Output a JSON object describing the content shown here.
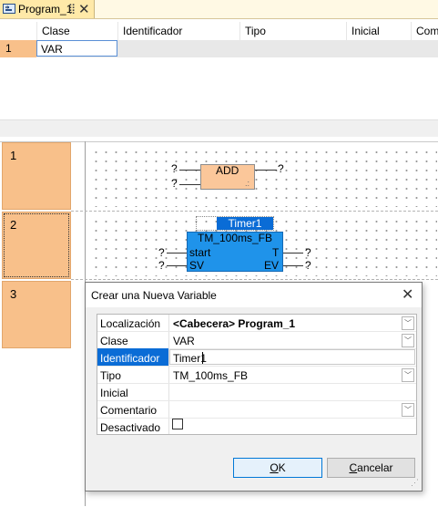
{
  "tab": {
    "title": "Program_1",
    "pin_glyph": "⣿",
    "close_glyph": "✕",
    "icon": "program-icon"
  },
  "var_table": {
    "columns": [
      "Clase",
      "Identificador",
      "Tipo",
      "Inicial",
      "Come"
    ],
    "rows": [
      {
        "num": "1",
        "clase": "VAR"
      }
    ]
  },
  "scrollbar": {
    "left_arrow": "‹"
  },
  "rungs": [
    {
      "num": "1",
      "block": "ADD",
      "inputs": [
        "?",
        "?"
      ],
      "output": "?"
    },
    {
      "num": "2",
      "instance": "Timer1",
      "block_type": "TM_100ms_FB",
      "inputs": [
        {
          "pin": "start",
          "value": "?"
        },
        {
          "pin": "SV",
          "value": "?"
        }
      ],
      "outputs": [
        {
          "pin": "T",
          "value": "?"
        },
        {
          "pin": "EV",
          "value": "?"
        }
      ]
    },
    {
      "num": "3"
    }
  ],
  "dialog": {
    "title": "Crear una Nueva Variable",
    "close_glyph": "✕",
    "fields": {
      "localizacion": {
        "label": "Localización",
        "value": "<Cabecera> Program_1"
      },
      "clase": {
        "label": "Clase",
        "value": "VAR"
      },
      "identificador": {
        "label": "Identificador",
        "value": "Timer1"
      },
      "tipo": {
        "label": "Tipo",
        "value": "TM_100ms_FB"
      },
      "inicial": {
        "label": "Inicial",
        "value": ""
      },
      "comentario": {
        "label": "Comentario",
        "value": ""
      },
      "desactivado": {
        "label": "Desactivado",
        "checked": false
      }
    },
    "dropdown_glyph": "﹀",
    "ok": {
      "prefix": "",
      "mnemonic": "O",
      "rest": "K"
    },
    "cancel": {
      "prefix": "",
      "mnemonic": "C",
      "rest": "ancelar"
    },
    "grip_glyph": "⋰"
  },
  "colors": {
    "accent": "#0a6cd6",
    "rung_number_bg": "#f8c08a",
    "timer_block": "#1f93ea",
    "add_block": "#fbc79a"
  }
}
